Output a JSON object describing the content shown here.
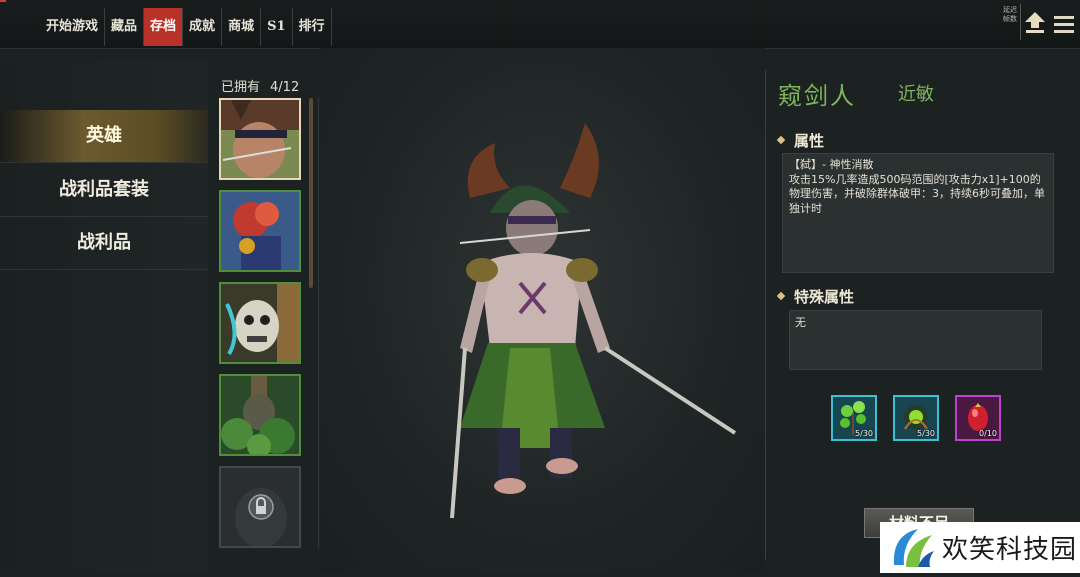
{
  "top_tabs": [
    {
      "label": "开始游戏"
    },
    {
      "label": "藏品"
    },
    {
      "label": "存档",
      "active": true
    },
    {
      "label": "成就"
    },
    {
      "label": "商城"
    },
    {
      "label": "S1"
    },
    {
      "label": "排行"
    }
  ],
  "top_right": {
    "label_line1": "延迟",
    "label_line2": "帧数",
    "upload_icon": "upload-arrow-icon",
    "menu_icon": "hamburger-menu-icon"
  },
  "sidebar": {
    "items": [
      {
        "label": "英雄",
        "active": true
      },
      {
        "label": "战利品套装"
      },
      {
        "label": "战利品"
      }
    ]
  },
  "hero_list": {
    "owned_label": "已拥有",
    "owned_count": "4/12",
    "cards": [
      {
        "name": "hero-portrait-1",
        "selected": true,
        "locked": false
      },
      {
        "name": "hero-portrait-2",
        "selected": false,
        "locked": false
      },
      {
        "name": "hero-portrait-3",
        "selected": false,
        "locked": false
      },
      {
        "name": "hero-portrait-4",
        "selected": false,
        "locked": false
      },
      {
        "name": "hero-portrait-5",
        "selected": false,
        "locked": true
      }
    ]
  },
  "hero_detail": {
    "name": "窥剑人",
    "class": "近敏",
    "attributes_title": "属性",
    "attributes_text": "【弑】- 神性消散\n攻击15%几率造成500码范围的[攻击力x1]+100的物理伤害，并破除群体破甲：3，持续6秒可叠加，单独计时",
    "special_title": "特殊属性",
    "special_text": "无",
    "materials": [
      {
        "icon": "herb-material-icon",
        "count": "5/30",
        "rarity": "cyan"
      },
      {
        "icon": "green-orb-material-icon",
        "count": "5/30",
        "rarity": "cyan"
      },
      {
        "icon": "red-gem-material-icon",
        "count": "0/10",
        "rarity": "purple"
      }
    ],
    "action_button": "材料不足"
  },
  "watermark": {
    "text": "欢笑科技园"
  },
  "colors": {
    "active_tab": "#b8322a",
    "hero_name": "#7fb45a",
    "card_border": "#4f8f3a"
  }
}
